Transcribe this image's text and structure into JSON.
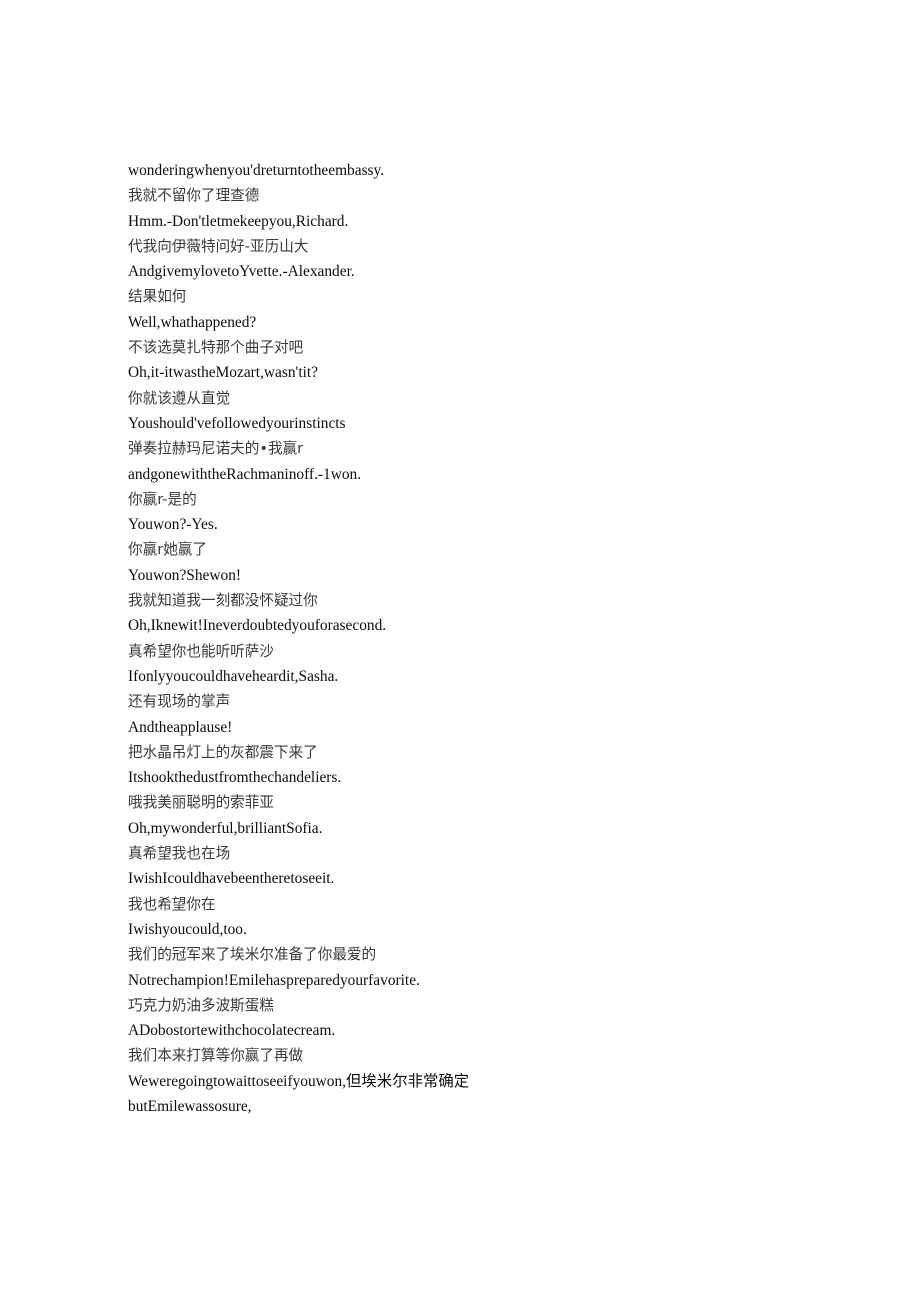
{
  "document": {
    "type": "bilingual-subtitle-transcript",
    "background_color": "#ffffff",
    "text_color_latin": "#0d0d0d",
    "text_color_cjk": "#3a3a3a",
    "lines": [
      {
        "text": "wonderingwhenyou'dreturntotheembassy.",
        "lang": "en"
      },
      {
        "text": "我就不留你了理查德",
        "lang": "zh"
      },
      {
        "text": "Hmm.-Don'tletmekeepyou,Richard.",
        "lang": "en"
      },
      {
        "text": "代我向伊薇特问好-亚历山大",
        "lang": "zh"
      },
      {
        "text": "AndgivemylovetoYvette.-Alexander.",
        "lang": "en"
      },
      {
        "text": "结果如何",
        "lang": "zh"
      },
      {
        "text": "Well,whathappened?",
        "lang": "en"
      },
      {
        "text": "不该选莫扎特那个曲子对吧",
        "lang": "zh"
      },
      {
        "text": "Oh,it-itwastheMozart,wasn'tit?",
        "lang": "en"
      },
      {
        "text": "你就该遵从直觉",
        "lang": "zh"
      },
      {
        "text": "Youshould'vefollowedyourinstincts",
        "lang": "en"
      },
      {
        "text": "弹奏拉赫玛尼诺夫的•我赢r",
        "lang": "zh"
      },
      {
        "text": "andgonewiththeRachmaninoff.-1won.",
        "lang": "en"
      },
      {
        "text": "你赢r-是的",
        "lang": "zh"
      },
      {
        "text": "Youwon?-Yes.",
        "lang": "en"
      },
      {
        "text": "你赢r她赢了",
        "lang": "zh"
      },
      {
        "text": "Youwon?Shewon!",
        "lang": "en"
      },
      {
        "text": "我就知道我一刻都没怀疑过你",
        "lang": "zh"
      },
      {
        "text": "Oh,Iknewit!Ineverdoubtedyouforasecond.",
        "lang": "en"
      },
      {
        "text": "真希望你也能听听萨沙",
        "lang": "zh"
      },
      {
        "text": "Ifonlyyoucouldhaveheardit,Sasha.",
        "lang": "en"
      },
      {
        "text": "还有现场的掌声",
        "lang": "zh"
      },
      {
        "text": "Andtheapplause!",
        "lang": "en"
      },
      {
        "text": "把水晶吊灯上的灰都震下来了",
        "lang": "zh"
      },
      {
        "text": "Itshookthedustfromthechandeliers.",
        "lang": "en"
      },
      {
        "text": "哦我美丽聪明的索菲亚",
        "lang": "zh"
      },
      {
        "text": "Oh,mywonderful,brilliantSofia.",
        "lang": "en"
      },
      {
        "text": "真希望我也在场",
        "lang": "zh"
      },
      {
        "text": "IwishIcouldhavebeentheretoseeit.",
        "lang": "en"
      },
      {
        "text": "我也希望你在",
        "lang": "zh"
      },
      {
        "text": "Iwishyoucould,too.",
        "lang": "en"
      },
      {
        "text": "我们的冠军来了埃米尔准备了你最爱的",
        "lang": "zh"
      },
      {
        "text": "Notrechampion!Emilehaspreparedyourfavorite.",
        "lang": "en"
      },
      {
        "text": "巧克力奶油多波斯蛋糕",
        "lang": "zh"
      },
      {
        "text": "ADobostortewithchocolatecream.",
        "lang": "en"
      },
      {
        "text": "我们本来打算等你赢了再做",
        "lang": "zh"
      },
      {
        "text": "Weweregoingtowaittoseeifyouwon,但埃米尔非常确定",
        "lang": "mixed"
      },
      {
        "text": "butEmilewassosure,",
        "lang": "en"
      }
    ]
  }
}
